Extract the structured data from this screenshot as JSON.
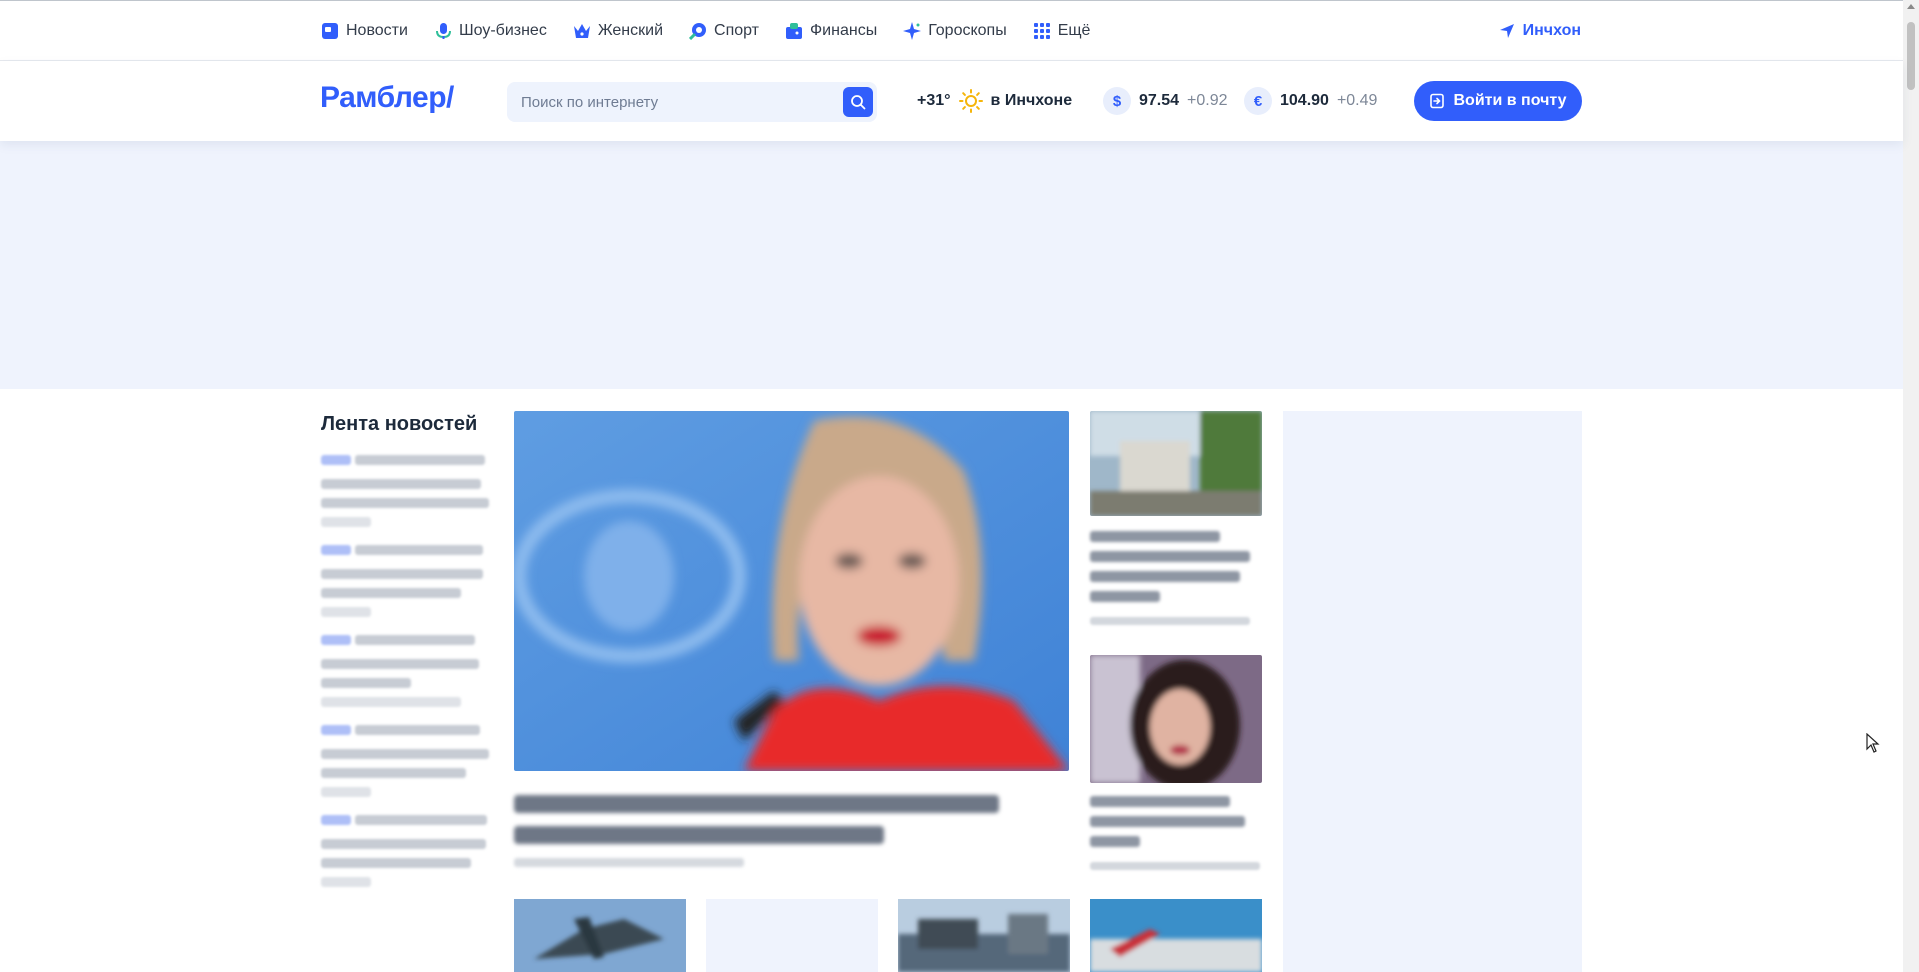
{
  "topnav": {
    "items": [
      {
        "label": "Новости",
        "icon": "news-icon",
        "color": "#315efb"
      },
      {
        "label": "Шоу-бизнес",
        "icon": "microphone-icon",
        "color": "#315efb"
      },
      {
        "label": "Женский",
        "icon": "crown-icon",
        "color": "#315efb"
      },
      {
        "label": "Спорт",
        "icon": "sport-icon",
        "color": "#315efb"
      },
      {
        "label": "Финансы",
        "icon": "wallet-icon",
        "color": "#315efb"
      },
      {
        "label": "Гороскопы",
        "icon": "star-icon",
        "color": "#315efb"
      },
      {
        "label": "Ещё",
        "icon": "grid-icon",
        "color": "#315efb"
      }
    ],
    "geo": "Инчхон"
  },
  "header": {
    "logo": "Рамблер/",
    "search_placeholder": "Поиск по интернету",
    "weather_temp": "+31°",
    "weather_city": "в Инчхоне",
    "usd_symbol": "$",
    "usd_value": "97.54",
    "usd_change": "+0.92",
    "eur_symbol": "€",
    "eur_value": "104.90",
    "eur_change": "+0.49",
    "login_label": "Войти в почту"
  },
  "feed": {
    "title": "Лента новостей"
  },
  "colors": {
    "accent": "#315efb",
    "banner_bg": "#eff3fd"
  }
}
